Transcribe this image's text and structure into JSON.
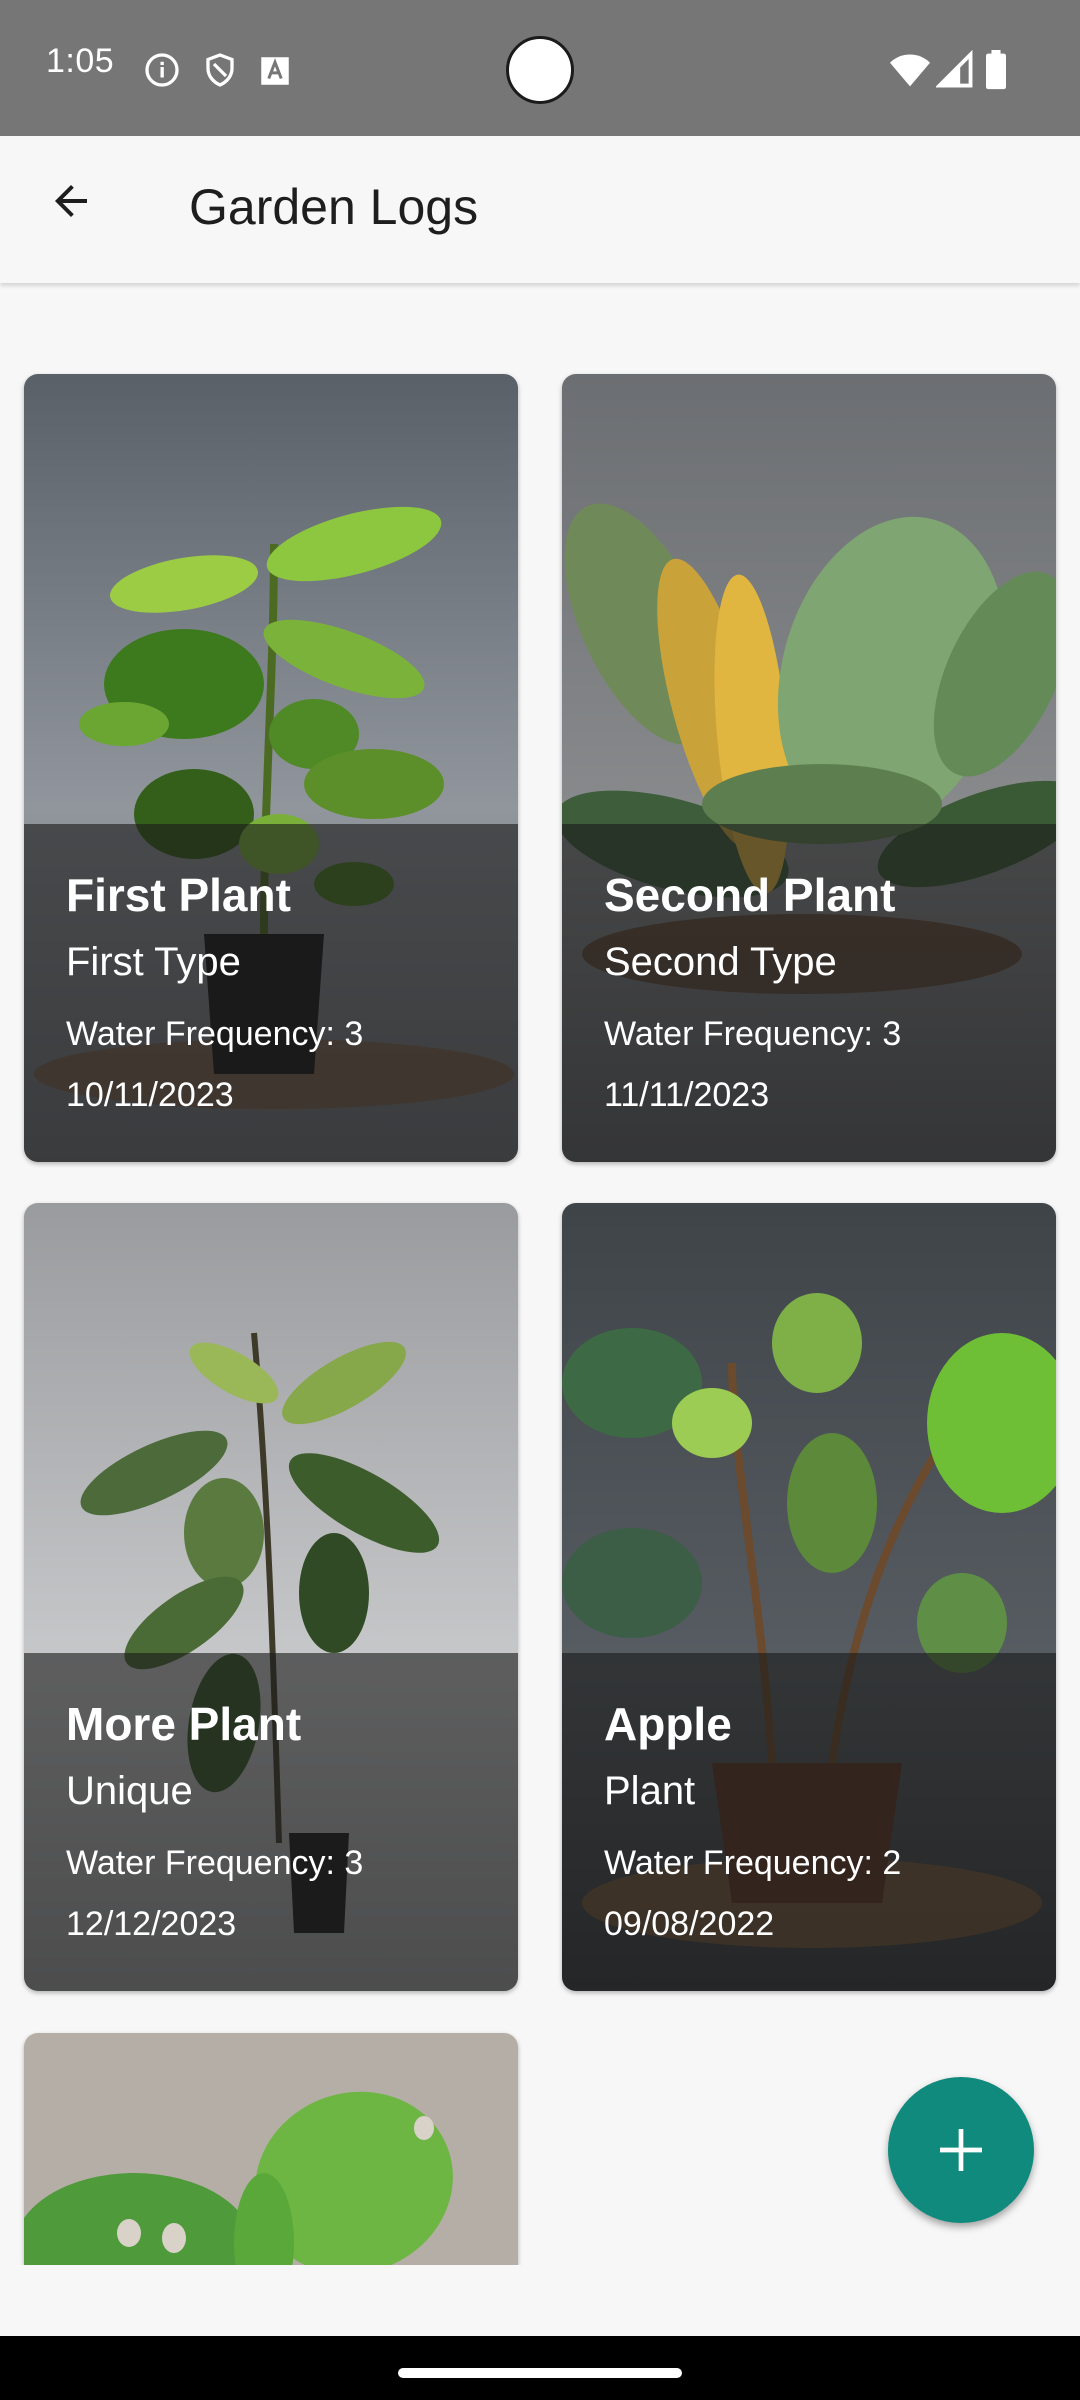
{
  "status_bar": {
    "time": "1:05",
    "icons": [
      "info-icon",
      "shield-icon",
      "font-icon",
      "wifi-icon",
      "signal-icon",
      "battery-icon"
    ]
  },
  "app_bar": {
    "title": "Garden Logs",
    "back_icon": "arrow-back-icon"
  },
  "plants": [
    {
      "name": "First Plant",
      "type": "First Type",
      "water": "Water Frequency: 3",
      "date": "10/11/2023",
      "image": "green-leafy-plant-in-pot"
    },
    {
      "name": "Second Plant",
      "type": "Second Type",
      "water": "Water Frequency: 3",
      "date": "11/11/2023",
      "image": "variegated-broadleaf-plant"
    },
    {
      "name": "More Plant",
      "type": "Unique",
      "water": "Water Frequency: 3",
      "date": "12/12/2023",
      "image": "tall-slim-plant-in-pot"
    },
    {
      "name": "Apple",
      "type": "Plant",
      "water": "Water Frequency: 2",
      "date": "09/08/2022",
      "image": "heart-leaf-plant-in-clay-pot"
    },
    {
      "name": "",
      "type": "",
      "water": "",
      "date": "",
      "image": "monstera-leaf-plant"
    }
  ],
  "fab": {
    "icon": "plus-icon"
  },
  "colors": {
    "status_bar": "#767676",
    "app_bar": "#f7f7f7",
    "fab": "#0f8a7d",
    "card_overlay": "rgba(28,28,28,0.62)"
  }
}
